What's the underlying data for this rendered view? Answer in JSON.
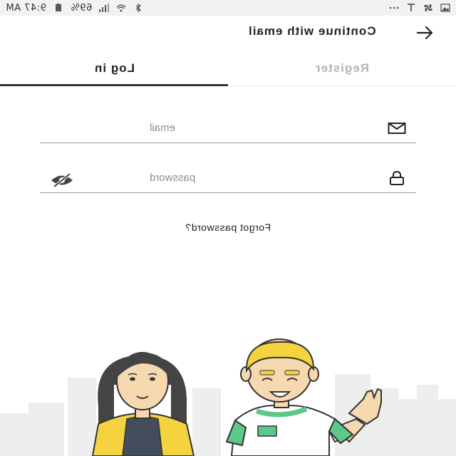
{
  "status_bar": {
    "time": "9:47 AM",
    "battery": "69%",
    "icons": [
      "more-icon",
      "t-icon",
      "fan-icon",
      "image-icon",
      "bluetooth-icon",
      "wifi-icon",
      "signal-icon",
      "battery-icon"
    ]
  },
  "app_bar": {
    "title": "Continue with email",
    "back_icon": "arrow-icon"
  },
  "tabs": [
    {
      "label": "Log in",
      "active": true
    },
    {
      "label": "Register",
      "active": false
    }
  ],
  "form": {
    "email_placeholder": "email",
    "email_value": "",
    "password_placeholder": "password",
    "password_value": "",
    "forgot_label": "Forgot password?"
  },
  "illustration": {
    "description_icons": [
      "woman-avatar",
      "man-waving-avatar",
      "city-skyline"
    ]
  },
  "colors": {
    "accent": "#333333",
    "inactive_tab": "#b5b5b5",
    "status_bar_bg": "#f2f2f2",
    "jacket": "#f5d33f",
    "shirt_trim": "#5cc88a"
  }
}
